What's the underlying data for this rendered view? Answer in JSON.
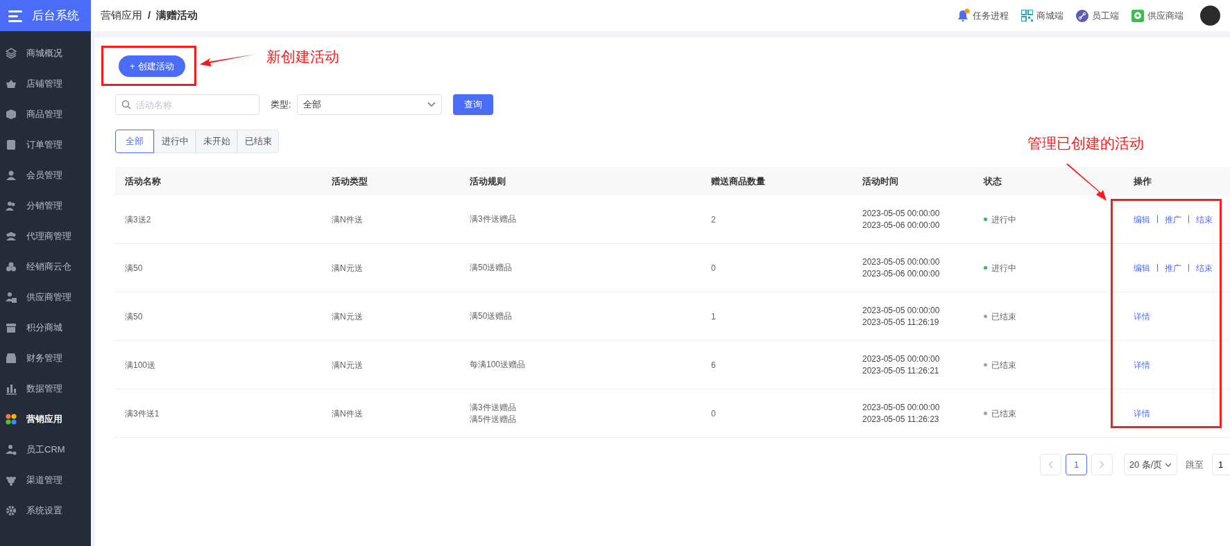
{
  "sidebar": {
    "title": "后台系统",
    "items": [
      {
        "label": "商城概况",
        "selected": false
      },
      {
        "label": "店铺管理",
        "selected": false
      },
      {
        "label": "商品管理",
        "selected": false
      },
      {
        "label": "订单管理",
        "selected": false
      },
      {
        "label": "会员管理",
        "selected": false
      },
      {
        "label": "分销管理",
        "selected": false
      },
      {
        "label": "代理商管理",
        "selected": false
      },
      {
        "label": "经销商云仓",
        "selected": false
      },
      {
        "label": "供应商管理",
        "selected": false
      },
      {
        "label": "积分商城",
        "selected": false
      },
      {
        "label": "财务管理",
        "selected": false
      },
      {
        "label": "数据管理",
        "selected": false
      },
      {
        "label": "营销应用",
        "selected": true
      },
      {
        "label": "员工CRM",
        "selected": false
      },
      {
        "label": "渠道管理",
        "selected": false
      },
      {
        "label": "系统设置",
        "selected": false
      }
    ]
  },
  "header": {
    "breadcrumb": [
      "营销应用",
      "满赠活动"
    ],
    "breadcrumb_separator": "/",
    "links": [
      {
        "label": "任务进程",
        "kind": "bell",
        "badge": true
      },
      {
        "label": "商城端",
        "kind": "qr"
      },
      {
        "label": "员工端",
        "kind": "link"
      },
      {
        "label": "供应商端",
        "kind": "chat"
      }
    ]
  },
  "create_button": {
    "icon": "+",
    "label": "创建活动"
  },
  "filters": {
    "search": {
      "placeholder": "活动名称"
    },
    "type_label": "类型:",
    "type_value": "全部",
    "query_button": "查询"
  },
  "tabs": [
    {
      "label": "全部",
      "selected": true
    },
    {
      "label": "进行中",
      "selected": false
    },
    {
      "label": "未开始",
      "selected": false
    },
    {
      "label": "已结束",
      "selected": false
    }
  ],
  "table": {
    "columns": [
      "活动名称",
      "活动类型",
      "活动规则",
      "赠送商品数量",
      "活动时间",
      "状态",
      "操作"
    ],
    "rows": [
      {
        "name": "满3送2",
        "type": "满N件送",
        "rules": [
          "满3件送赠品"
        ],
        "quantity": "2",
        "time": [
          "2023-05-05 00:00:00",
          "2023-05-06 00:00:00"
        ],
        "status": "进行中",
        "color": "#19be6b",
        "actions": [
          "编辑",
          "推广",
          "结束"
        ]
      },
      {
        "name": "满50",
        "type": "满N元送",
        "rules": [
          "满50送赠品"
        ],
        "quantity": "0",
        "time": [
          "2023-05-05 00:00:00",
          "2023-05-06 00:00:00"
        ],
        "status": "进行中",
        "color": "#19be6b",
        "actions": [
          "编辑",
          "推广",
          "结束"
        ]
      },
      {
        "name": "满50",
        "type": "满N元送",
        "rules": [
          "满50送赠品"
        ],
        "quantity": "1",
        "time": [
          "2023-05-05 00:00:00",
          "2023-05-05 11:26:19"
        ],
        "status": "已结束",
        "color": "#9ca3af",
        "actions": [
          "详情"
        ]
      },
      {
        "name": "满100送",
        "type": "满N元送",
        "rules": [
          "每满100送赠品"
        ],
        "quantity": "6",
        "time": [
          "2023-05-05 00:00:00",
          "2023-05-05 11:26:21"
        ],
        "status": "已结束",
        "color": "#9ca3af",
        "actions": [
          "详情"
        ]
      },
      {
        "name": "满3件送1",
        "type": "满N件送",
        "rules": [
          "满3件送赠品",
          "满5件送赠品"
        ],
        "quantity": "0",
        "time": [
          "2023-05-05 00:00:00",
          "2023-05-05 11:26:23"
        ],
        "status": "已结束",
        "color": "#9ca3af",
        "actions": [
          "详情"
        ]
      }
    ]
  },
  "pagination": {
    "pages": [
      {
        "label": "1",
        "selected": true
      }
    ],
    "page_size": "20 条/页",
    "jump_label": "跳至",
    "jump_value": "1"
  },
  "annotations": [
    {
      "kind": "create",
      "text": "新创建活动"
    },
    {
      "kind": "manage",
      "text": "管理已创建的活动"
    }
  ]
}
